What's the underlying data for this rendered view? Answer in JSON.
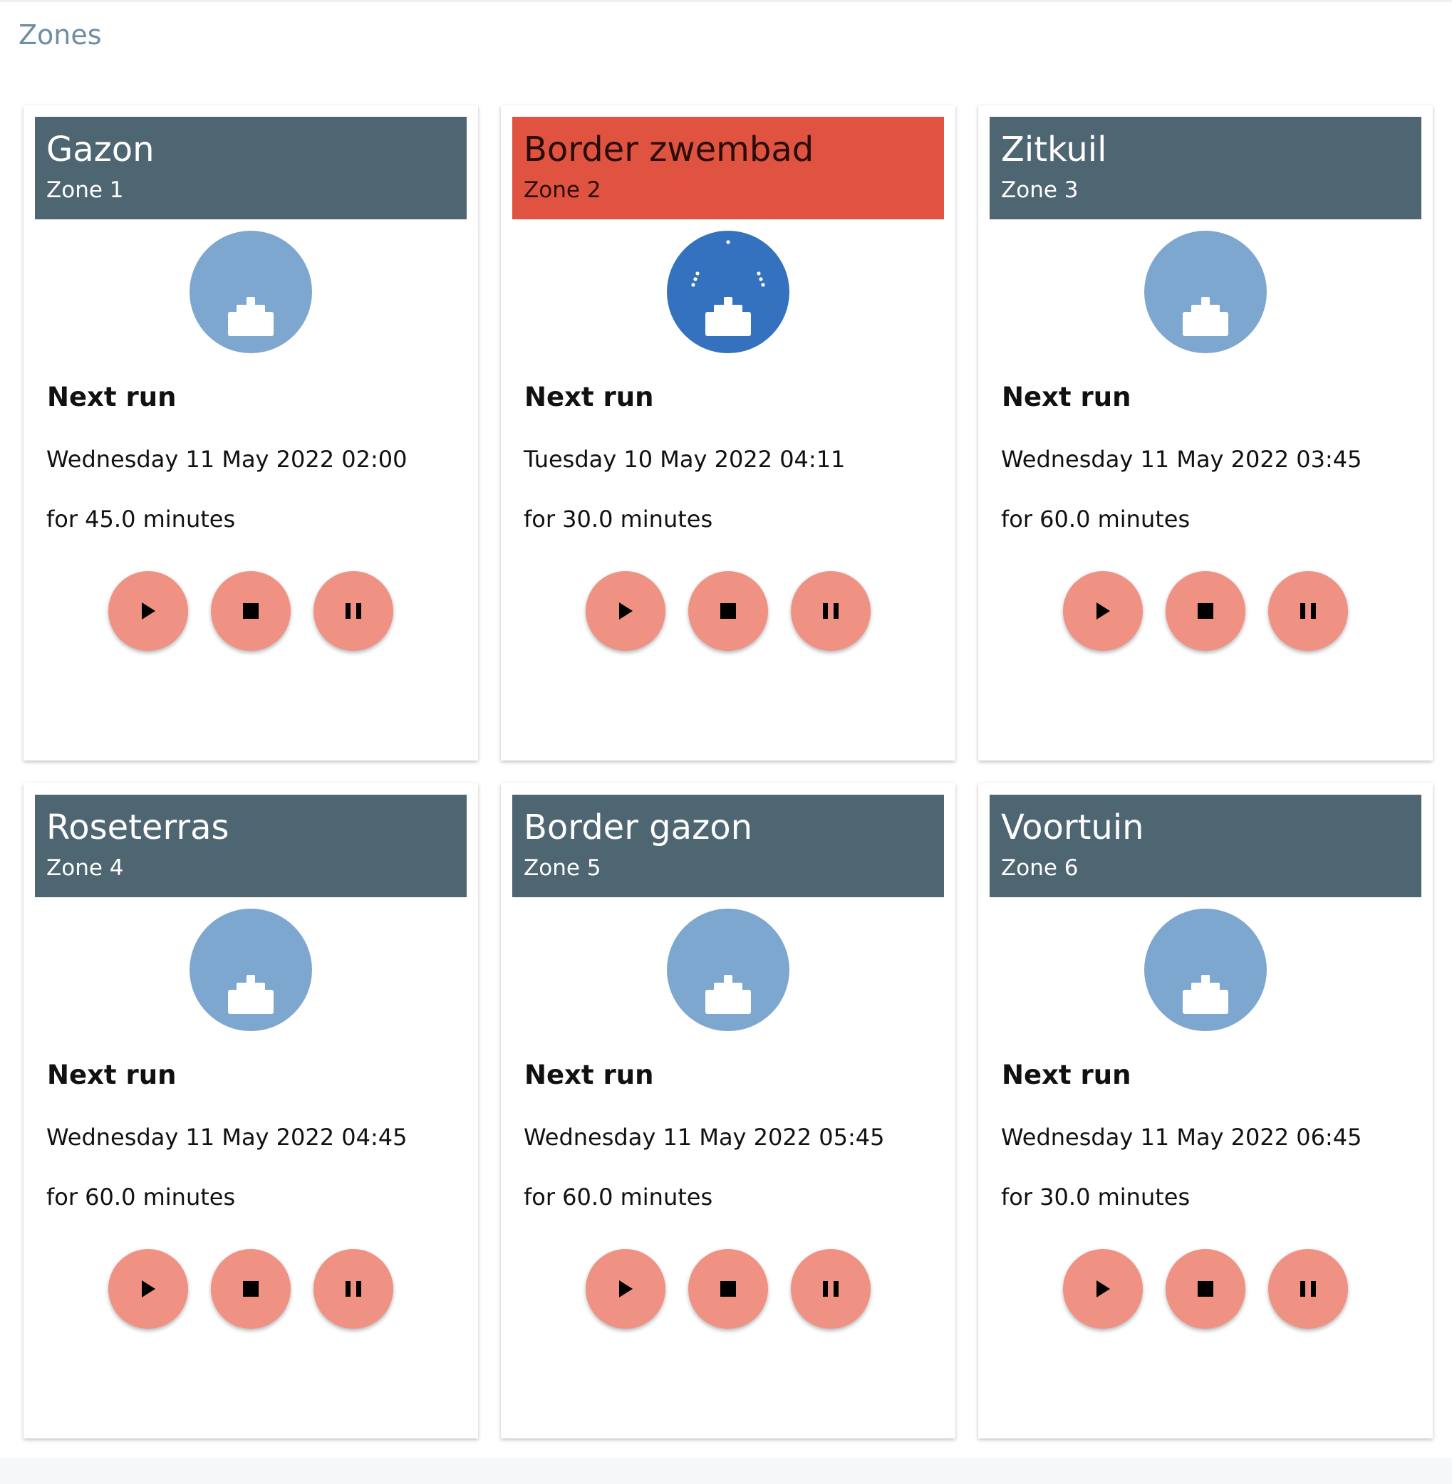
{
  "page": {
    "title": "Zones"
  },
  "labels": {
    "next_run": "Next run"
  },
  "colors": {
    "header_default": "#4e6572",
    "header_active": "#e05340",
    "sprinkler_idle": "#7ea7cf",
    "sprinkler_active": "#3472c0",
    "control_button": "#ef9283"
  },
  "icons": {
    "sprinkler": "sprinkler-icon",
    "play": "play-icon",
    "stop": "stop-icon",
    "pause": "pause-icon"
  },
  "zones": [
    {
      "name": "Gazon",
      "zone": "Zone 1",
      "active": false,
      "next_run_date": "Wednesday 11 May 2022 02:00",
      "duration": "for 45.0 minutes"
    },
    {
      "name": "Border zwembad",
      "zone": "Zone 2",
      "active": true,
      "next_run_date": "Tuesday 10 May 2022 04:11",
      "duration": "for 30.0 minutes"
    },
    {
      "name": "Zitkuil",
      "zone": "Zone 3",
      "active": false,
      "next_run_date": "Wednesday 11 May 2022 03:45",
      "duration": "for 60.0 minutes"
    },
    {
      "name": "Roseterras",
      "zone": "Zone 4",
      "active": false,
      "next_run_date": "Wednesday 11 May 2022 04:45",
      "duration": "for 60.0 minutes"
    },
    {
      "name": "Border gazon",
      "zone": "Zone 5",
      "active": false,
      "next_run_date": "Wednesday 11 May 2022 05:45",
      "duration": "for 60.0 minutes"
    },
    {
      "name": "Voortuin",
      "zone": "Zone 6",
      "active": false,
      "next_run_date": "Wednesday 11 May 2022 06:45",
      "duration": "for 30.0 minutes"
    }
  ]
}
